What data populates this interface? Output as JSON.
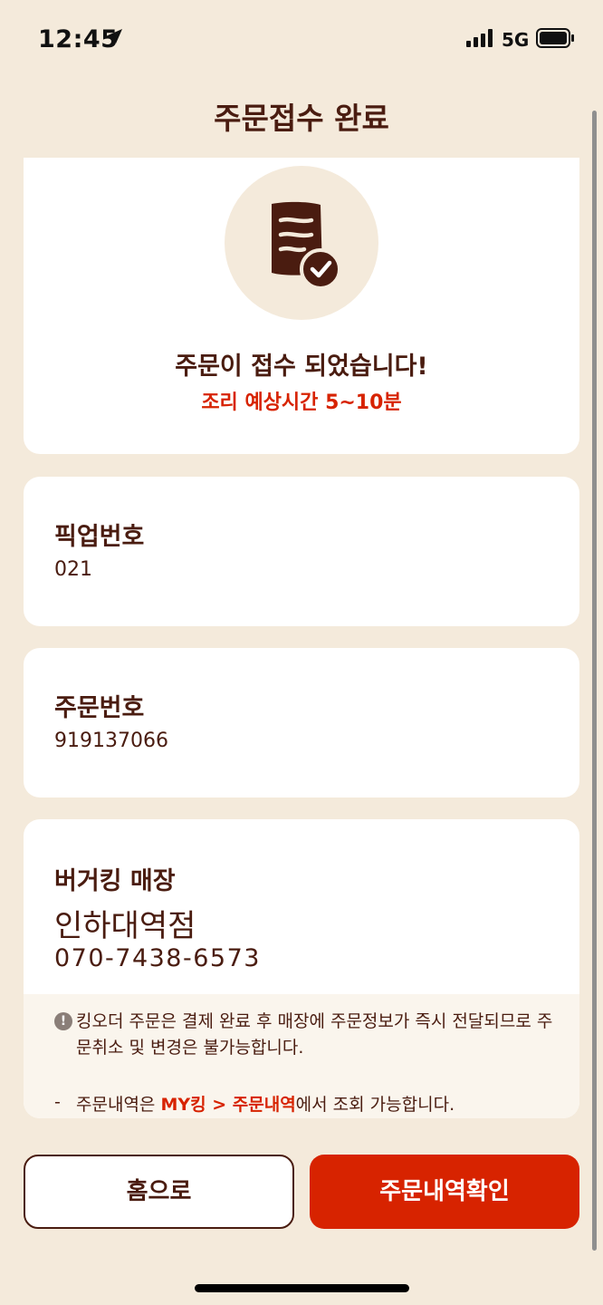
{
  "status_bar": {
    "time": "12:45",
    "network": "5G"
  },
  "header": {
    "title": "주문접수 완료"
  },
  "confirmation": {
    "icon": "receipt-check-icon",
    "message": "주문이 접수 되었습니다!",
    "cook_time": "조리 예상시간  5~10분"
  },
  "pickup": {
    "label": "픽업번호",
    "value": "021"
  },
  "order": {
    "label": "주문번호",
    "value": "919137066"
  },
  "store": {
    "label": "버거킹 매장",
    "name": "인하대역점",
    "phone": "070-7438-6573"
  },
  "notice": {
    "icon": "exclamation-icon",
    "text": "킹오더 주문은 결제 완료 후 매장에 주문정보가 즉시 전달되므로 주문취소 및 변경은 불가능합니다.",
    "line2_dash": "-",
    "line2_prefix": "주문내역은 ",
    "line2_link": "MY킹 > 주문내역",
    "line2_suffix": "에서 조회 가능합니다."
  },
  "buttons": {
    "home": "홈으로",
    "history": "주문내역확인"
  },
  "colors": {
    "background": "#f4eadb",
    "brand_brown": "#4a1c10",
    "accent_red": "#d72300"
  }
}
